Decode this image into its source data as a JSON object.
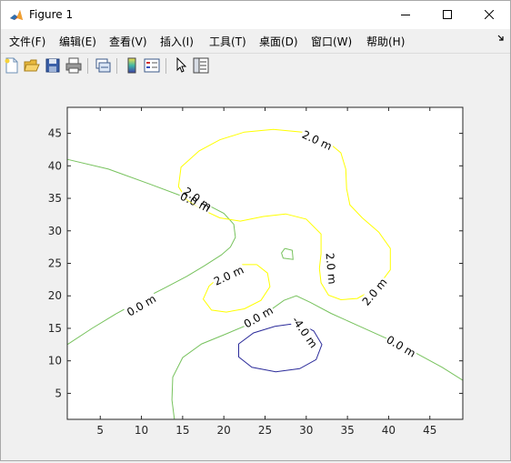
{
  "window": {
    "title": "Figure 1",
    "icon": "matlab-logo-icon",
    "controls": [
      "minimize-icon",
      "maximize-icon",
      "close-icon"
    ]
  },
  "menubar": {
    "items": [
      {
        "label": "文件(F)"
      },
      {
        "label": "编辑(E)"
      },
      {
        "label": "查看(V)"
      },
      {
        "label": "插入(I)"
      },
      {
        "label": "工具(T)"
      },
      {
        "label": "桌面(D)"
      },
      {
        "label": "窗口(W)"
      },
      {
        "label": "帮助(H)"
      }
    ],
    "overflow_icon": "corner-arrow-icon"
  },
  "toolbar": {
    "buttons": [
      {
        "icon": "new-figure-icon"
      },
      {
        "icon": "open-file-icon"
      },
      {
        "icon": "save-icon"
      },
      {
        "icon": "print-icon"
      },
      {
        "icon": "link-plot-icon"
      },
      {
        "icon": "insert-colorbar-icon"
      },
      {
        "icon": "insert-legend-icon"
      },
      {
        "icon": "edit-plot-pointer-icon"
      },
      {
        "icon": "property-inspector-icon"
      }
    ]
  },
  "chart_data": {
    "type": "contour",
    "xlim": [
      1,
      49
    ],
    "ylim": [
      1,
      49
    ],
    "xticks": [
      5,
      10,
      15,
      20,
      25,
      30,
      35,
      40,
      45
    ],
    "yticks": [
      5,
      10,
      15,
      20,
      25,
      30,
      35,
      40,
      45
    ],
    "grid": false,
    "colors": {
      "0.0": "#77c25d",
      "2.0": "#ffff00",
      "-4.0": "#2b2b9a"
    },
    "contours": [
      {
        "level": 0.0,
        "label": "0.0 m",
        "points": [
          [
            1,
            41
          ],
          [
            6,
            39.5
          ],
          [
            11,
            37.2
          ],
          [
            15,
            35.3
          ],
          [
            18,
            34
          ],
          [
            20,
            32.7
          ],
          [
            21.2,
            31
          ],
          [
            21.4,
            29
          ],
          [
            20.8,
            27.5
          ],
          [
            19.7,
            26.3
          ],
          [
            17.6,
            24.6
          ],
          [
            15.5,
            23
          ],
          [
            12.8,
            21.2
          ],
          [
            10,
            19.4
          ],
          [
            7,
            17.3
          ],
          [
            4,
            15
          ],
          [
            1,
            12.5
          ]
        ],
        "labels": [
          {
            "text": "0.0 m",
            "x": 16.5,
            "y": 34.4,
            "angle": 25
          },
          {
            "text": "0.0 m",
            "x": 10,
            "y": 18.5,
            "angle": -30
          }
        ]
      },
      {
        "level": 0.0,
        "label": "0.0 m",
        "points": [
          [
            14,
            1
          ],
          [
            13.7,
            4
          ],
          [
            13.8,
            7.5
          ],
          [
            15,
            10.5
          ],
          [
            17.3,
            12.6
          ],
          [
            20,
            14
          ],
          [
            23,
            15.6
          ],
          [
            25.2,
            17.4
          ],
          [
            27.3,
            19.3
          ],
          [
            28.8,
            20
          ],
          [
            30.5,
            19
          ],
          [
            33,
            17.3
          ],
          [
            36.5,
            15.3
          ],
          [
            40,
            13.3
          ],
          [
            43.3,
            11.2
          ],
          [
            46.5,
            9
          ],
          [
            49,
            7
          ]
        ],
        "labels": [
          {
            "text": "0.0 m",
            "x": 24.2,
            "y": 16.7,
            "angle": -30
          },
          {
            "text": "0.0 m",
            "x": 41.5,
            "y": 12.2,
            "angle": 30
          }
        ]
      },
      {
        "level": 0.0,
        "label": "",
        "points": [
          [
            27.4,
            27.3
          ],
          [
            28.3,
            27
          ],
          [
            28.4,
            25.6
          ],
          [
            27.2,
            25.8
          ],
          [
            27,
            26.6
          ],
          [
            27.4,
            27.3
          ]
        ],
        "labels": []
      },
      {
        "level": 2.0,
        "label": "2.0 m",
        "points": [
          [
            15.5,
            34.8
          ],
          [
            14.5,
            36.8
          ],
          [
            14.8,
            39.8
          ],
          [
            17,
            42.3
          ],
          [
            19.5,
            44
          ],
          [
            22.5,
            45.2
          ],
          [
            26,
            45.6
          ],
          [
            29.5,
            45.2
          ],
          [
            32.3,
            44
          ],
          [
            34.2,
            42
          ],
          [
            34.8,
            39.5
          ],
          [
            34.9,
            36.5
          ],
          [
            35.3,
            34
          ],
          [
            36.8,
            32
          ],
          [
            38.8,
            29.8
          ],
          [
            40.2,
            27.3
          ],
          [
            40.2,
            24
          ],
          [
            38.6,
            21.3
          ],
          [
            36.2,
            19.6
          ],
          [
            34.2,
            19.4
          ],
          [
            32.7,
            20.1
          ],
          [
            31.8,
            22
          ],
          [
            31.6,
            24.2
          ],
          [
            31.8,
            26.5
          ],
          [
            31.8,
            29.5
          ],
          [
            30,
            31.8
          ],
          [
            27.5,
            32.6
          ],
          [
            24.8,
            32.2
          ],
          [
            22,
            31.5
          ],
          [
            19.5,
            32
          ],
          [
            17.5,
            33.2
          ],
          [
            15.5,
            34.8
          ]
        ],
        "labels": [
          {
            "text": "2.0 m",
            "x": 31.3,
            "y": 43.9,
            "angle": 25
          },
          {
            "text": "2.0 m",
            "x": 16.8,
            "y": 34.9,
            "angle": 35
          },
          {
            "text": "2.0 m",
            "x": 33,
            "y": 24.2,
            "angle": 85
          },
          {
            "text": "2.0 m",
            "x": 38.3,
            "y": 20.6,
            "angle": -50
          }
        ]
      },
      {
        "level": 2.0,
        "label": "2.0 m",
        "points": [
          [
            24,
            24.8
          ],
          [
            25.3,
            23.5
          ],
          [
            25.6,
            21.4
          ],
          [
            24.5,
            19.3
          ],
          [
            22.5,
            18
          ],
          [
            20.3,
            17.5
          ],
          [
            18.5,
            17.8
          ],
          [
            17.5,
            19.5
          ],
          [
            18.2,
            21.5
          ],
          [
            19.8,
            23.3
          ],
          [
            21.8,
            24.8
          ],
          [
            24,
            24.8
          ]
        ],
        "labels": [
          {
            "text": "2.0 m",
            "x": 20.6,
            "y": 23.1,
            "angle": -25
          }
        ]
      },
      {
        "level": -4.0,
        "label": "-4.0 m",
        "points": [
          [
            29,
            15.8
          ],
          [
            30.9,
            14.6
          ],
          [
            31.9,
            12.5
          ],
          [
            31.2,
            10.2
          ],
          [
            29.2,
            8.8
          ],
          [
            26.3,
            8.3
          ],
          [
            23.4,
            9
          ],
          [
            21.8,
            10.6
          ],
          [
            21.8,
            12.6
          ],
          [
            23.6,
            14.3
          ],
          [
            26.2,
            15.3
          ],
          [
            29,
            15.8
          ]
        ],
        "labels": [
          {
            "text": "-4.0 m",
            "x": 29.8,
            "y": 14.4,
            "angle": 55
          }
        ]
      }
    ]
  }
}
